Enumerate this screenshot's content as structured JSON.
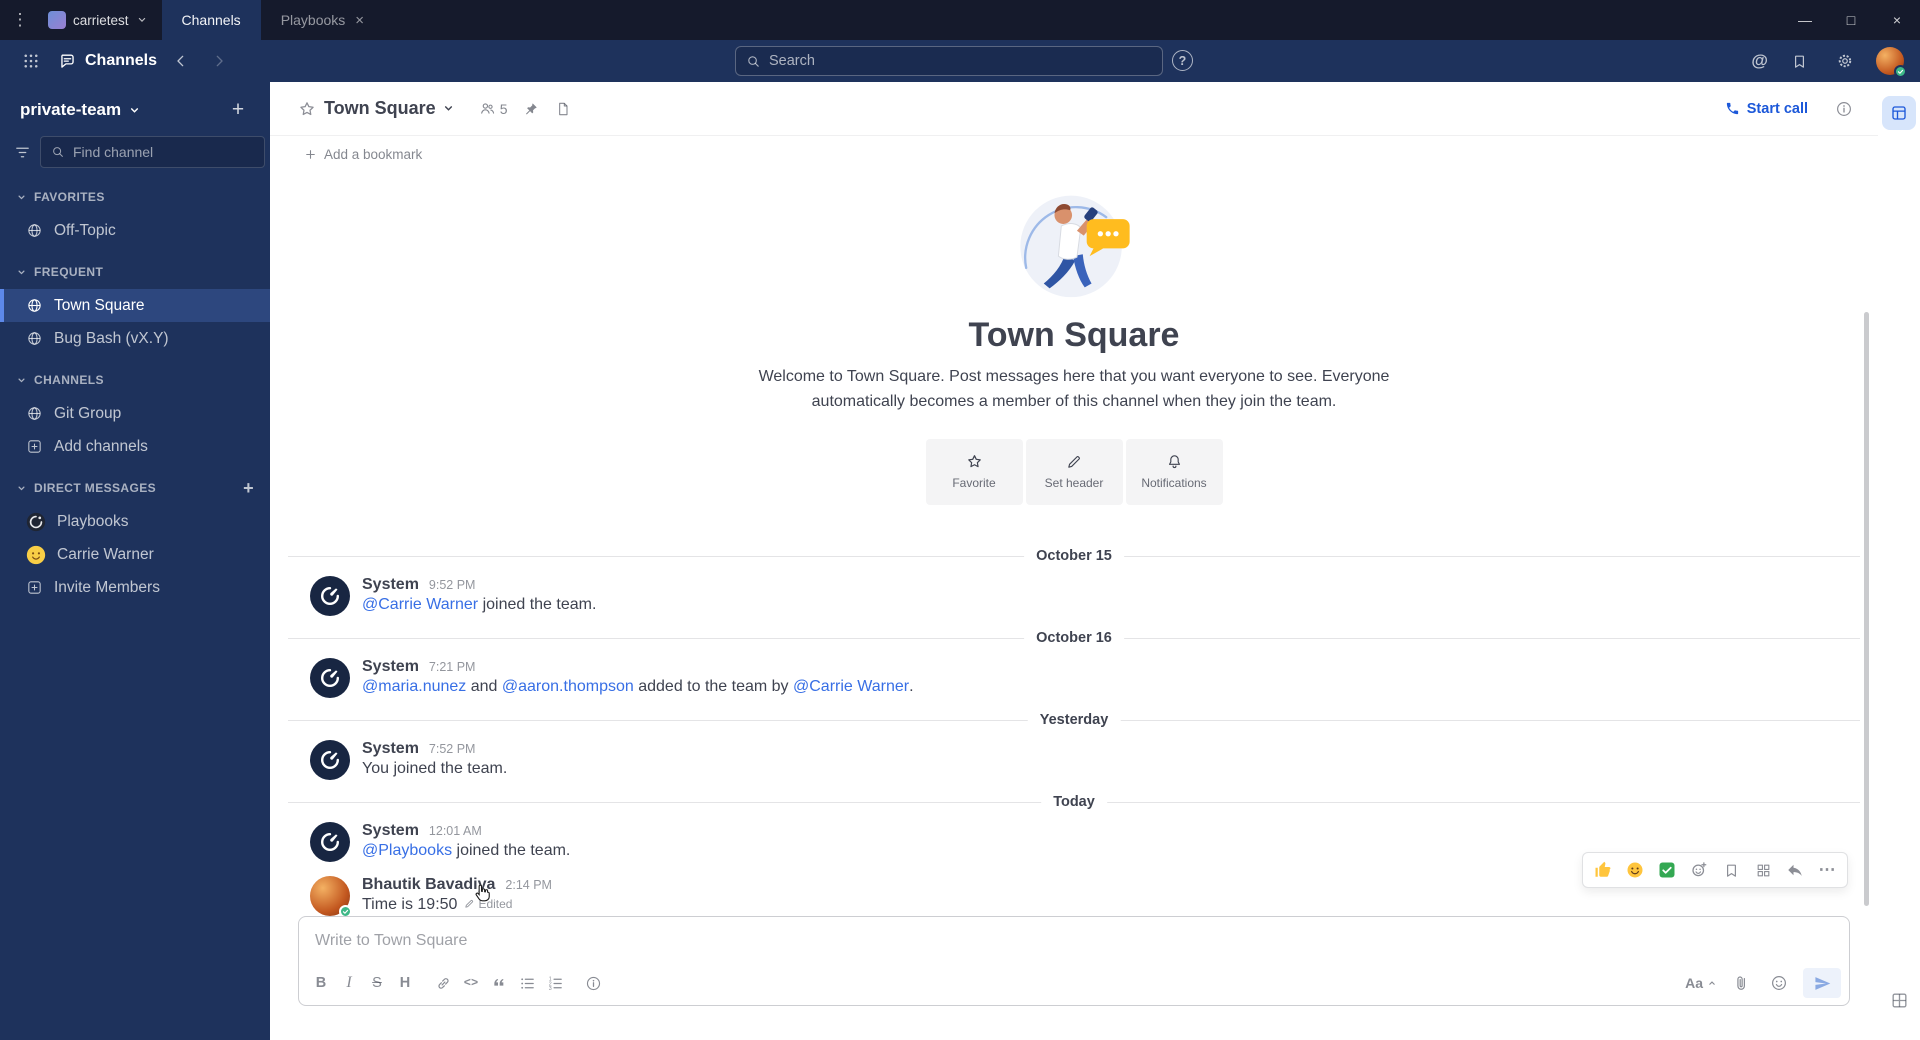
{
  "glyphs": {
    "app_menu": "⋮",
    "minimize": "—",
    "maximize": "□",
    "close": "×",
    "tab_close": "×",
    "plus": "+",
    "at_mention": "@",
    "help": "?",
    "bold": "B",
    "italic": "I",
    "strikethrough": "S",
    "heading": "H",
    "code": "<>",
    "more": "⋯",
    "formatting": "Aa"
  },
  "titlebar": {
    "server_name": "carrietest",
    "tab_channels": "Channels",
    "tab_playbooks": "Playbooks"
  },
  "global_header": {
    "product_name": "Channels",
    "search_placeholder": "Search"
  },
  "sidebar": {
    "team_name": "private-team",
    "find_channel_placeholder": "Find channel",
    "sections": [
      {
        "label": "FAVORITES"
      },
      {
        "label": "FREQUENT"
      },
      {
        "label": "CHANNELS"
      },
      {
        "label": "DIRECT MESSAGES"
      }
    ],
    "favorites": [
      {
        "name": "Off-Topic"
      }
    ],
    "frequent": [
      {
        "name": "Town Square"
      },
      {
        "name": "Bug Bash (vX.Y)"
      }
    ],
    "channels": [
      {
        "name": "Git Group"
      },
      {
        "name": "Add channels"
      }
    ],
    "dms": [
      {
        "name": "Playbooks"
      },
      {
        "name": "Carrie Warner"
      },
      {
        "name": "Invite Members"
      }
    ]
  },
  "channel_header": {
    "title": "Town Square",
    "member_count": "5",
    "start_call_label": "Start call"
  },
  "bookmark_bar": {
    "add_label": "Add a bookmark"
  },
  "intro": {
    "title": "Town Square",
    "description": "Welcome to Town Square. Post messages here that you want everyone to see. Everyone automatically becomes a member of this channel when they join the team.",
    "favorite_label": "Favorite",
    "set_header_label": "Set header",
    "notifications_label": "Notifications"
  },
  "timeline": {
    "divider1": "October 15",
    "msg1": {
      "user": "System",
      "time": "9:52 PM",
      "link1": "@Carrie Warner",
      "text1": " joined the team."
    },
    "divider2": "October 16",
    "msg2": {
      "user": "System",
      "time": "7:21 PM",
      "link1": "@maria.nunez",
      "text1": " and ",
      "link2": "@aaron.thompson",
      "text2": " added to the team by ",
      "link3": "@Carrie Warner",
      "text3": "."
    },
    "divider3": "Yesterday",
    "msg3": {
      "user": "System",
      "time": "7:52 PM",
      "text1": "You joined the team."
    },
    "divider4": "Today",
    "msg4": {
      "user": "System",
      "time": "12:01 AM",
      "link1": "@Playbooks",
      "text1": " joined the team."
    },
    "msg5": {
      "user": "Bhautik Bavadiya",
      "time": "2:14 PM",
      "text1": "Time is 19:50",
      "edited": "Edited"
    }
  },
  "composer": {
    "placeholder": "Write to Town Square"
  },
  "colors": {
    "titlebar_bg": "#151a2c",
    "header_bg": "#1e325c",
    "accent": "#1c58d9",
    "link": "#386fe5",
    "selected_border": "#5d89ea",
    "selected_item_bg": "#2d477e"
  }
}
